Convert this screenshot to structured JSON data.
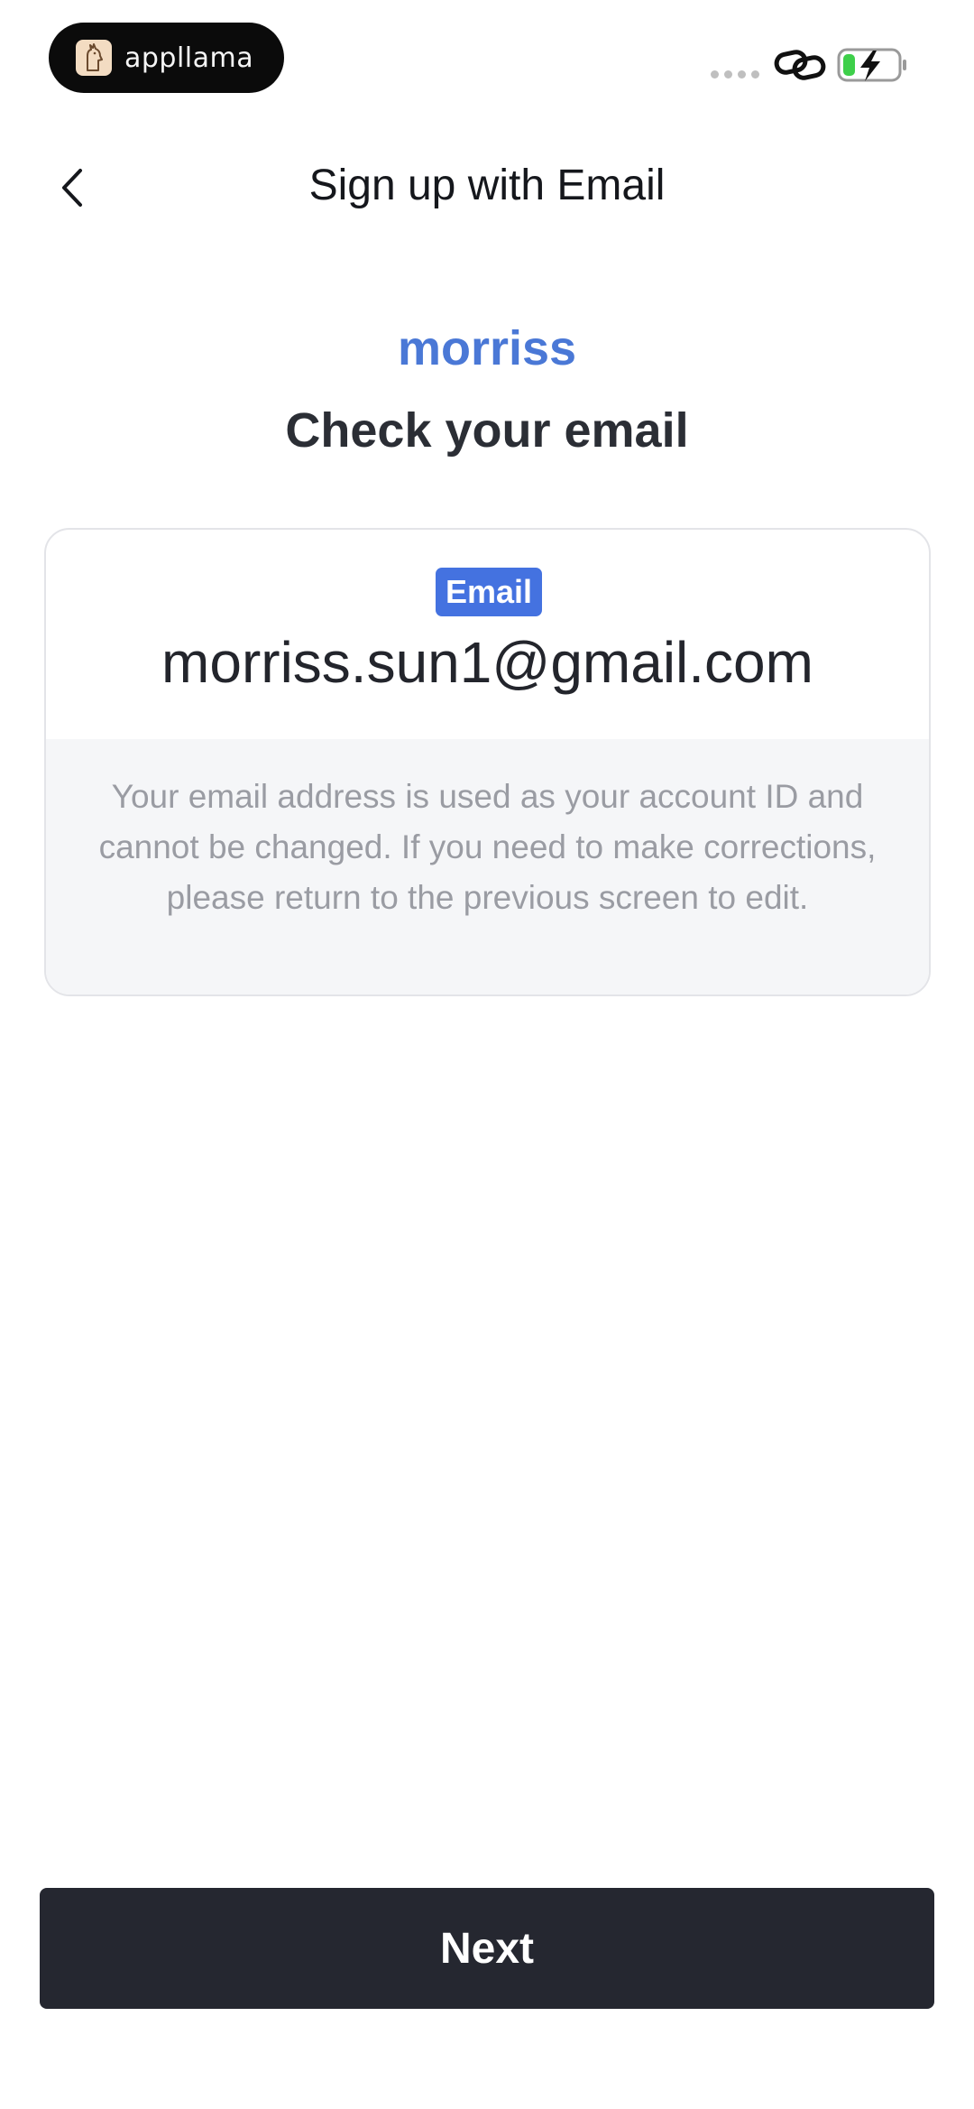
{
  "status_bar": {
    "app_name": "appllama",
    "icons": [
      "llama-logo-icon",
      "link-icon",
      "battery-charging-icon"
    ],
    "battery_color": "#3ecf4a"
  },
  "nav": {
    "back_icon": "chevron-left-icon",
    "title": "Sign up with Email"
  },
  "main": {
    "username": "morriss",
    "heading": "Check your email"
  },
  "email_card": {
    "badge_label": "Email",
    "email": "morriss.sun1@gmail.com",
    "notice": "Your email address is used as your account ID and cannot be changed. If you need to make corrections, please return to the previous screen to edit."
  },
  "footer": {
    "next_label": "Next"
  },
  "colors": {
    "accent": "#4472e0",
    "username": "#4a78d6",
    "button_bg": "#252730"
  }
}
